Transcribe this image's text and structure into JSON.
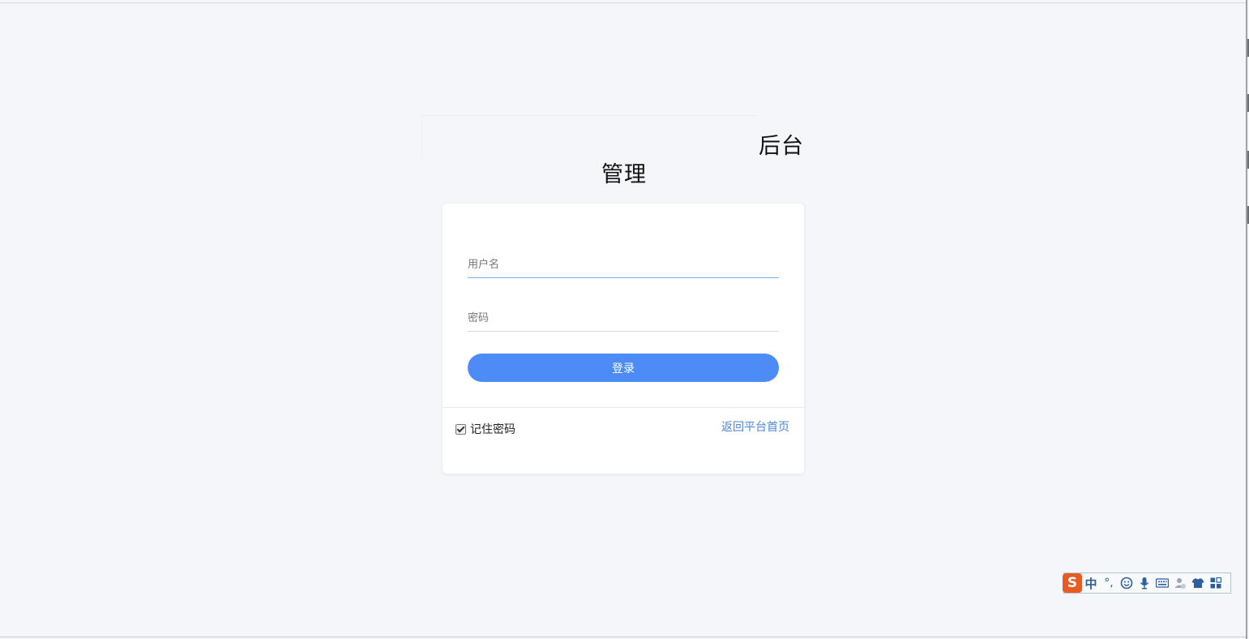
{
  "page": {
    "title_part1": "后台",
    "title_part2": "管理"
  },
  "login_form": {
    "username_placeholder": "用户名",
    "password_placeholder": "密码",
    "login_button": "登录",
    "remember_label": "记住密码",
    "remember_checked": true,
    "back_link": "返回平台首页"
  },
  "ime": {
    "logo": "S",
    "mode": "中",
    "punct": "°,",
    "icons": [
      "smiley-icon",
      "microphone-icon",
      "keyboard-icon",
      "user-icon",
      "shirt-icon",
      "grid-icon"
    ]
  },
  "colors": {
    "primary": "#4d8cf7",
    "link": "#4a86d8",
    "background": "#f4f6fa"
  }
}
